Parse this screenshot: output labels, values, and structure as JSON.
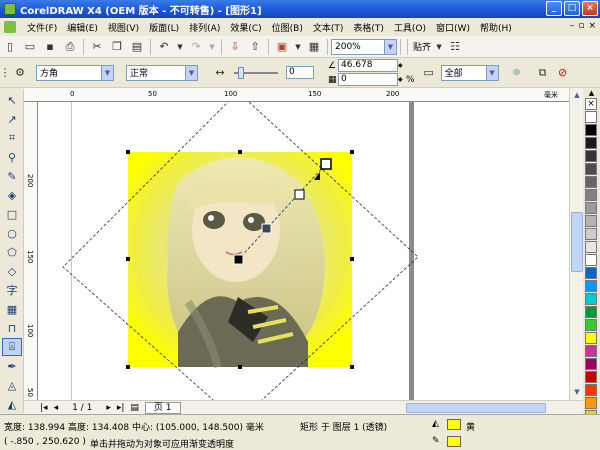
{
  "window": {
    "title": "CorelDRAW X4 (OEM 版本 - 不可转售) - [图形1]"
  },
  "menu": [
    "文件(F)",
    "编辑(E)",
    "视图(V)",
    "版面(L)",
    "排列(A)",
    "效果(C)",
    "位图(B)",
    "文本(T)",
    "表格(T)",
    "工具(O)",
    "窗口(W)",
    "帮助(H)"
  ],
  "toolbar": {
    "zoom": "200%",
    "snap_label": "贴齐"
  },
  "property_bar": {
    "transparency_type": "方角",
    "merge_mode": "正常",
    "midpoint": "0",
    "angle": "46.678",
    "edge_pad": "0",
    "edge_unit": "%",
    "target": "全部"
  },
  "rulers": {
    "h_labels": [
      "0",
      "50",
      "100",
      "150",
      "200"
    ],
    "h_unit": "毫米",
    "v_labels": [
      "200",
      "150",
      "100",
      "50"
    ],
    "v_unit": "毫米"
  },
  "pages": {
    "counter": "1 / 1",
    "tab": "页 1"
  },
  "status": {
    "size": "宽度: 138.994 高度: 134.408 中心: (105.000, 148.500) 毫米",
    "object": "矩形 于 图层 1 (透镜)",
    "coords": "( -.850 , 250.620 )",
    "hint": "单击并拖动为对象可应用渐变透明度",
    "fill_name": "黄",
    "fill_color": "#ffff00",
    "outline_color": "#ffff00"
  },
  "palette": [
    "#ffffff",
    "#000000",
    "#1a1a1a",
    "#333333",
    "#4d4d4d",
    "#666666",
    "#808080",
    "#999999",
    "#b3b3b3",
    "#cccccc",
    "#e6e6e6",
    "#ffffff",
    "#0066cc",
    "#0099ff",
    "#00cccc",
    "#009933",
    "#33cc33",
    "#ffff00",
    "#cc3399",
    "#990066",
    "#cc0000",
    "#ff3300",
    "#ff9900",
    "#ffcc00"
  ]
}
